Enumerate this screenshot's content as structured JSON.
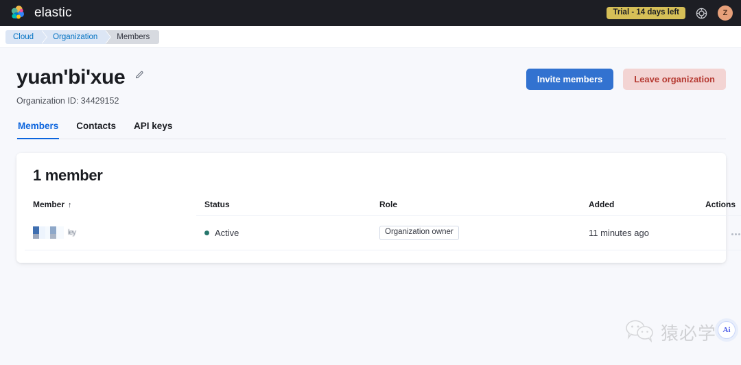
{
  "topnav": {
    "brand": "elastic",
    "logo_icon": "elastic-logo-icon",
    "trial_badge": "Trial - 14 days left",
    "deployment_icon": "deployment-globe-icon",
    "avatar_initial": "Z",
    "colors": {
      "bg": "#1D1E24",
      "trial_bg": "#D6BF57",
      "avatar_bg": "#E7A07A"
    }
  },
  "breadcrumb": {
    "items": [
      {
        "label": "Cloud",
        "current": false
      },
      {
        "label": "Organization",
        "current": false
      },
      {
        "label": "Members",
        "current": true
      }
    ]
  },
  "page": {
    "title": "yuan'bi'xue",
    "edit_icon": "pencil-edit-icon",
    "org_id_label": "Organization ID: 34429152",
    "actions": {
      "invite": "Invite members",
      "leave": "Leave organization"
    },
    "colors": {
      "primary": "#3272D0",
      "danger_bg": "#F3D4D3",
      "danger_text": "#B63B33"
    }
  },
  "tabs": [
    {
      "label": "Members",
      "active": true
    },
    {
      "label": "Contacts",
      "active": false
    },
    {
      "label": "API keys",
      "active": false
    }
  ],
  "card": {
    "title": "1 member",
    "columns": {
      "member": "Member",
      "status": "Status",
      "role": "Role",
      "added": "Added",
      "actions": "Actions"
    },
    "sort": {
      "column": "Member",
      "direction": "asc",
      "glyph": "↑"
    },
    "rows": [
      {
        "member_name": "[redacted]",
        "member_redacted_tail": "ley",
        "status": "Active",
        "status_color": "#26766C",
        "role": "Organization owner",
        "added": "11 minutes ago",
        "actions_icon": "more-horizontal-icon"
      }
    ]
  },
  "watermark": {
    "icon": "wechat-icon",
    "text": "猿必学"
  },
  "ai_button": {
    "label": "Ai"
  }
}
